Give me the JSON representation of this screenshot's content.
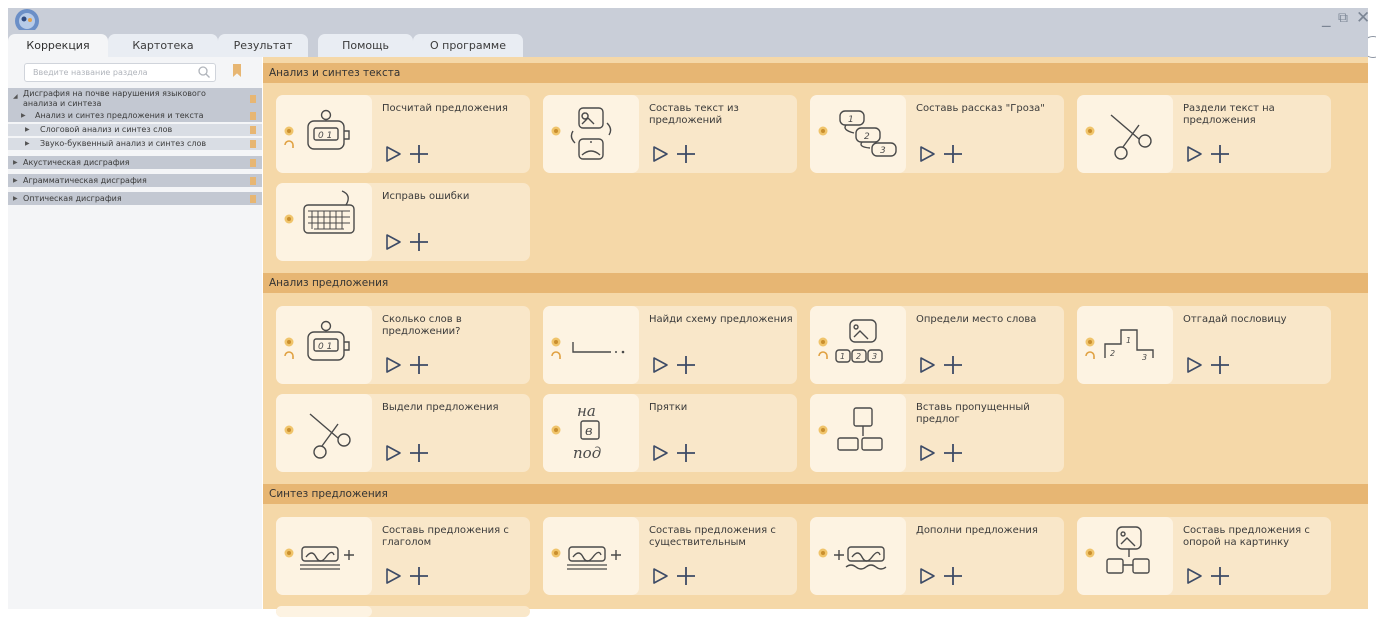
{
  "window": {
    "minimize": "_",
    "restore": "⧉",
    "close": "✕"
  },
  "tabs": [
    {
      "label": "Коррекция",
      "active": true
    },
    {
      "label": "Картотека",
      "active": false
    },
    {
      "label": "Результат",
      "active": false
    },
    {
      "label": "Помощь",
      "active": false
    },
    {
      "label": "О программе",
      "active": false
    }
  ],
  "sidebar": {
    "search_placeholder": "Введите название раздела",
    "tree": [
      {
        "label": "Дисграфия на почве нарушения языкового анализа и синтеза",
        "expanded": true
      },
      {
        "label": "Анализ и синтез предложения и текста",
        "selected": true
      },
      {
        "label": "Слоговой анализ и синтез слов"
      },
      {
        "label": "Звуко-буквенный анализ и синтез слов"
      },
      {
        "label": "Акустическая дисграфия"
      },
      {
        "label": "Аграмматическая дисграфия"
      },
      {
        "label": "Оптическая дисграфия"
      }
    ]
  },
  "sections": [
    {
      "title": "Анализ и синтез текста",
      "cards": [
        {
          "title": "Посчитай предложения",
          "icon": "counter-icon"
        },
        {
          "title": "Составь текст из предложений",
          "icon": "pictures-cycle-icon"
        },
        {
          "title": "Составь рассказ \"Гроза\"",
          "icon": "numbered-cards-icon"
        },
        {
          "title": "Раздели текст на предложения",
          "icon": "scissors-icon"
        },
        {
          "title": "Исправь ошибки",
          "icon": "keyboard-icon"
        }
      ]
    },
    {
      "title": "Анализ предложения",
      "cards": [
        {
          "title": "Сколько слов в предложении?",
          "icon": "counter-icon"
        },
        {
          "title": "Найди схему предложения",
          "icon": "sentence-scheme-icon"
        },
        {
          "title": "Определи место слова",
          "icon": "picture-numbers-icon"
        },
        {
          "title": "Отгадай пословицу",
          "icon": "podium-icon"
        },
        {
          "title": "Выдели предложения",
          "icon": "scissors-icon"
        },
        {
          "title": "Прятки",
          "icon": "handwriting-icon",
          "icon_text": [
            "на",
            "в",
            "под"
          ]
        },
        {
          "title": "Вставь пропущенный предлог",
          "icon": "preposition-blocks-icon"
        }
      ]
    },
    {
      "title": "Синтез предложения",
      "cards": [
        {
          "title": "Составь предложения с глаголом",
          "icon": "handwriting-plus-icon"
        },
        {
          "title": "Составь предложения с существительным",
          "icon": "handwriting-plus-icon"
        },
        {
          "title": "Дополни предложения",
          "icon": "plus-handwriting-icon"
        },
        {
          "title": "Составь предложения с опорой на картинку",
          "icon": "picture-scheme-icon"
        }
      ]
    }
  ]
}
